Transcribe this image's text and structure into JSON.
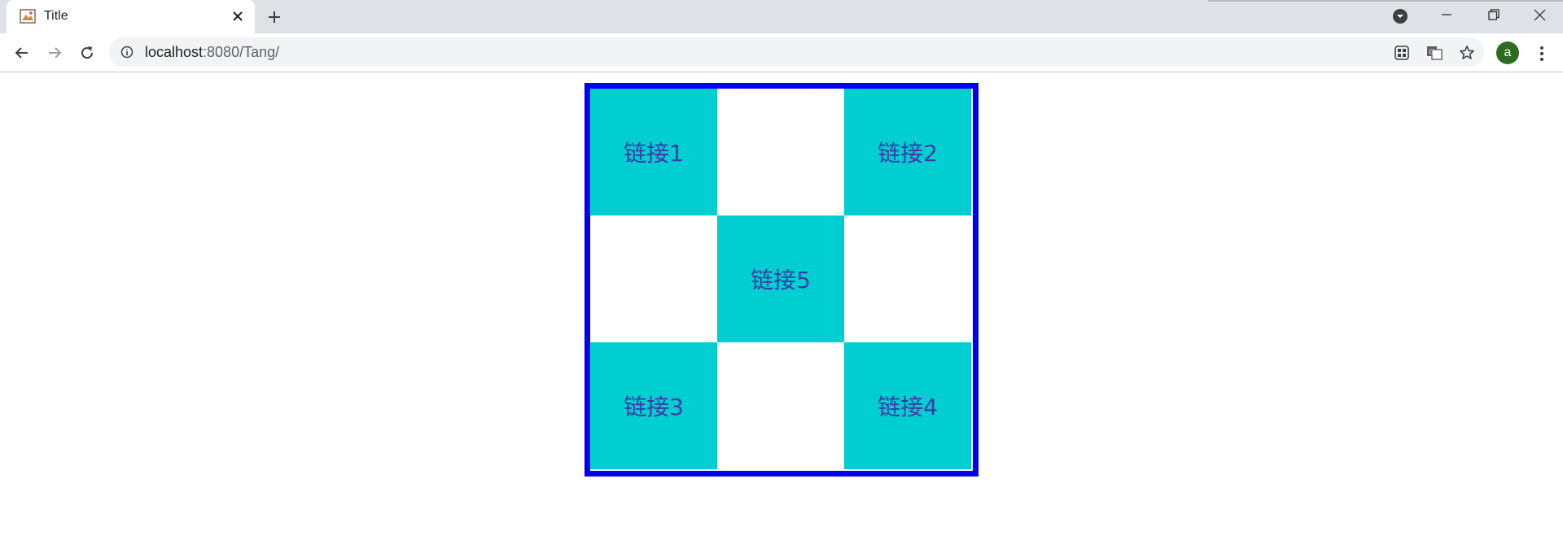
{
  "browser": {
    "tab": {
      "title": "Title"
    },
    "address_bar": {
      "host": "localhost",
      "rest": ":8080/Tang/"
    },
    "profile_initial": "a",
    "colors": {
      "tabstrip": "#dee1e6",
      "avatar": "#2e6b1f"
    }
  },
  "page": {
    "links": [
      {
        "label": "链接1"
      },
      {
        "label": "链接2"
      },
      {
        "label": "链接3"
      },
      {
        "label": "链接4"
      },
      {
        "label": "链接5"
      }
    ],
    "colors": {
      "border": "#0000ee",
      "cell": "#00ced1",
      "link_text": "#3b3ba8"
    }
  }
}
